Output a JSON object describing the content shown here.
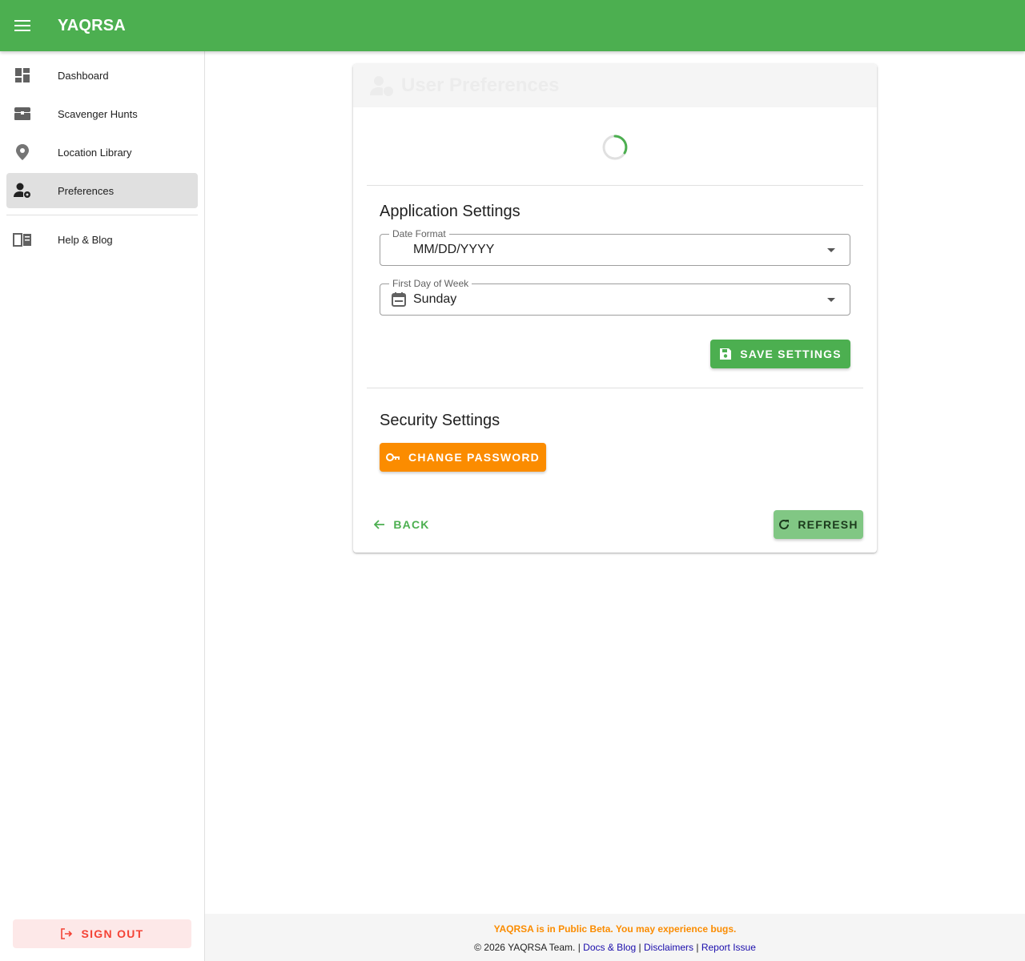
{
  "app": {
    "title": "YAQRSA"
  },
  "appbar": {
    "menu_icon": "menu-icon"
  },
  "sidebar": {
    "items": [
      {
        "label": "Dashboard",
        "icon": "dashboard-icon"
      },
      {
        "label": "Scavenger Hunts",
        "icon": "treasure-chest-icon"
      },
      {
        "label": "Location Library",
        "icon": "map-pin-icon"
      },
      {
        "label": "Preferences",
        "icon": "user-settings-icon",
        "active": true
      },
      {
        "label": "Help & Blog",
        "icon": "book-icon"
      }
    ],
    "signout_label": "SIGN OUT"
  },
  "card": {
    "title": "User Preferences",
    "app_settings": {
      "title": "Application Settings",
      "date_format": {
        "label": "Date Format",
        "value": "MM/DD/YYYY"
      },
      "first_day": {
        "label": "First Day of Week",
        "value": "Sunday"
      },
      "save_label": "SAVE SETTINGS"
    },
    "security": {
      "title": "Security Settings",
      "change_password_label": "CHANGE PASSWORD"
    },
    "back_label": "BACK",
    "refresh_label": "REFRESH"
  },
  "footer": {
    "beta_notice": "YAQRSA is in Public Beta. You may experience bugs.",
    "copyright": "© 2026 YAQRSA Team.",
    "sep": "|",
    "links": [
      "Docs & Blog",
      "Disclaimers",
      "Report Issue"
    ]
  },
  "colors": {
    "primary": "#4caf50",
    "accent": "#fb8c00",
    "danger": "#f44336"
  }
}
